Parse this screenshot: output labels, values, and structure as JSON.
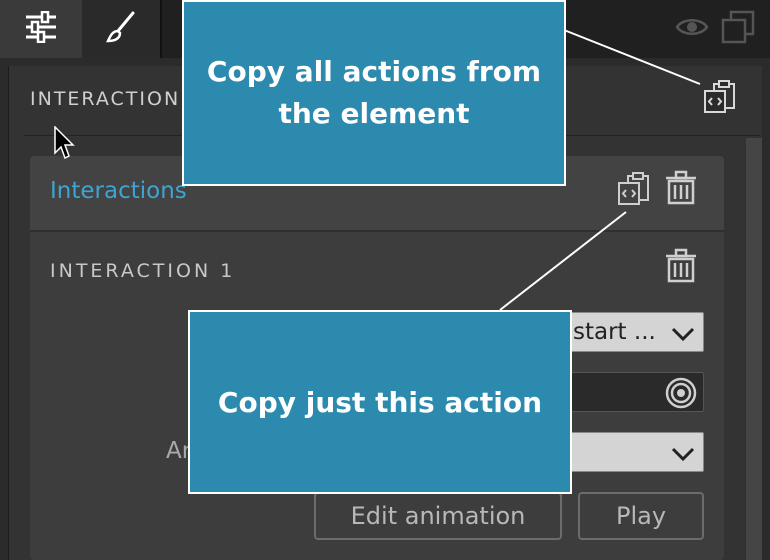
{
  "toolbar": {
    "icons": [
      "sliders-icon",
      "brush-icon",
      "eye-icon",
      "duplicate-icon"
    ]
  },
  "panel": {
    "title": "INTERACTION",
    "card": {
      "heading": "Interactions",
      "interaction": {
        "label": "INTERACTION 1",
        "trigger_value": "start ...",
        "animation_label": "An",
        "edit_button": "Edit animation",
        "play_button": "Play"
      }
    }
  },
  "callouts": {
    "copy_all": "Copy all actions from the element",
    "copy_one": "Copy just this action"
  },
  "colors": {
    "accent": "#3fa4cf",
    "callout_bg": "#2b8aae"
  }
}
